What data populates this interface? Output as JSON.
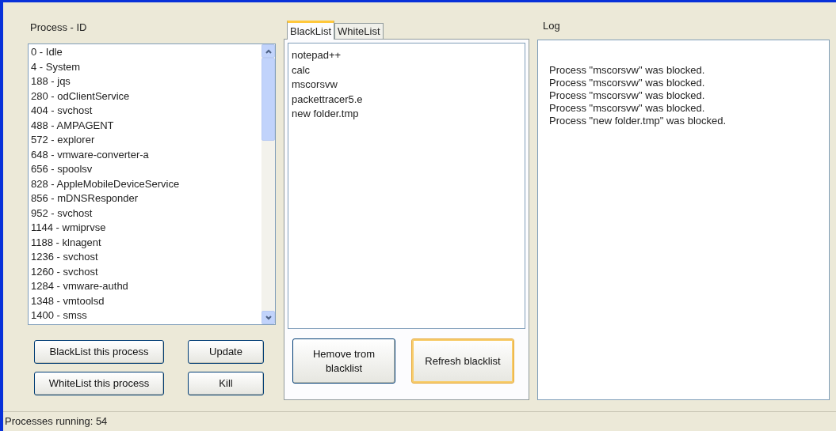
{
  "processes": {
    "label": "Process - ID",
    "items": [
      "0 - Idle",
      "4 - System",
      "188 - jqs",
      "280 - odClientService",
      "404 - svchost",
      "488 - AMPAGENT",
      "572 - explorer",
      "648 - vmware-converter-a",
      "656 - spoolsv",
      "828 - AppleMobileDeviceService",
      "856 - mDNSResponder",
      "952 - svchost",
      "1144 - wmiprvse",
      "1188 - klnagent",
      "1236 - svchost",
      "1260 - svchost",
      "1284 - vmware-authd",
      "1348 - vmtoolsd",
      "1400 - smss"
    ],
    "buttons": [
      "BlackList this process",
      "Update",
      "WhiteList this process",
      "Kill"
    ]
  },
  "lists": {
    "tabs": [
      {
        "label": "BlackList",
        "selected": true
      },
      {
        "label": "WhiteList",
        "selected": false
      }
    ],
    "items": [
      "notepad++",
      "calc",
      "mscorsvw",
      "packettracer5.e",
      "new folder.tmp"
    ],
    "buttons": [
      {
        "label": "Hemove trom\nblacklist",
        "focused": false
      },
      {
        "label": "Refresh blacklist",
        "focused": true
      }
    ]
  },
  "log": {
    "label": "Log",
    "lines": [
      "Process \"mscorsvw\" was blocked.",
      "Process \"mscorsvw\" was blocked.",
      "Process \"mscorsvw\" was blocked.",
      "Process \"mscorsvw\" was blocked.",
      "Process \"new folder.tmp\" was blocked."
    ]
  },
  "status_bar": "Processes running: 54"
}
